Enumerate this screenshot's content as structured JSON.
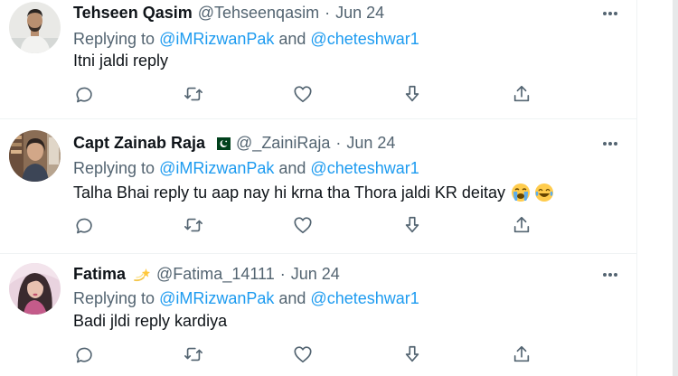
{
  "tweets": [
    {
      "name": "Tehseen Qasim",
      "handle": "@Tehseenqasim",
      "separator": "·",
      "date": "Jun 24",
      "replying_prefix": "Replying to ",
      "replying_user1": "@iMRizwanPak",
      "replying_and": " and ",
      "replying_user2": "@cheteshwar1",
      "text": "Itni jaldi reply"
    },
    {
      "name": "Capt Zainab Raja",
      "handle": "@_ZainiRaja",
      "separator": "·",
      "date": "Jun 24",
      "replying_prefix": "Replying to ",
      "replying_user1": "@iMRizwanPak",
      "replying_and": " and ",
      "replying_user2": "@cheteshwar1",
      "text": "Talha Bhai reply tu aap nay hi krna tha Thora jaldi KR deitay",
      "emojis": [
        "loudly-crying-face",
        "face-with-tears-of-joy"
      ]
    },
    {
      "name": "Fatima",
      "handle": "@Fatima_14111",
      "separator": "·",
      "date": "Jun 24",
      "replying_prefix": "Replying to ",
      "replying_user1": "@iMRizwanPak",
      "replying_and": " and ",
      "replying_user2": "@cheteshwar1",
      "text": "Badi jldi reply kardiya"
    }
  ],
  "icons": {
    "reply": "reply-icon",
    "retweet": "retweet-icon",
    "like": "like-icon",
    "downvote": "downvote-icon",
    "share": "share-icon",
    "more": "more-icon"
  },
  "colors": {
    "text": "#0f1419",
    "secondary": "#536471",
    "link": "#1d9bf0",
    "divider": "#eff3f4"
  }
}
